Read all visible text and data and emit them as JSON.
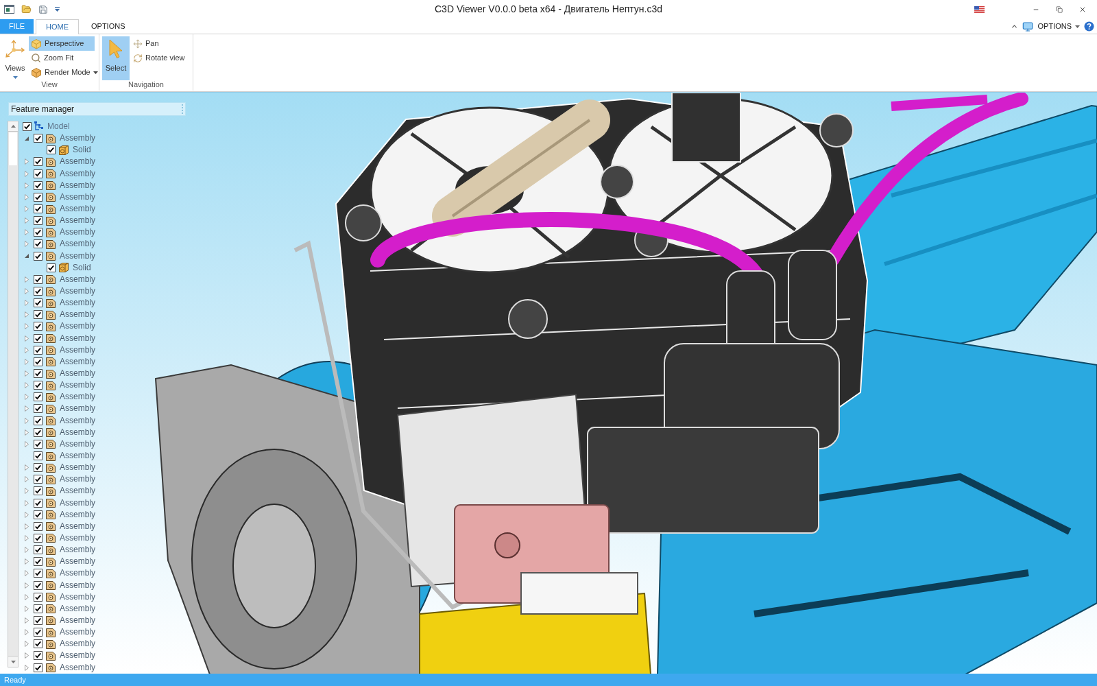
{
  "window": {
    "title": "C3D Viewer V0.0.0 beta x64 - Двигатель Нептун.c3d"
  },
  "ribbon": {
    "tabs": [
      {
        "label": "FILE",
        "kind": "file",
        "selected": false
      },
      {
        "label": "HOME",
        "kind": "tab",
        "selected": true
      },
      {
        "label": "OPTIONS",
        "kind": "tab",
        "selected": false
      }
    ],
    "options_menu": {
      "label": "OPTIONS"
    },
    "groups": [
      {
        "label": "View",
        "large": {
          "label": "Views",
          "selected": false,
          "dropdown": true
        },
        "small": [
          {
            "label": "Perspective",
            "selected": true,
            "dropdown": false
          },
          {
            "label": "Zoom Fit",
            "selected": false,
            "dropdown": false
          },
          {
            "label": "Render Mode",
            "selected": false,
            "dropdown": true
          }
        ]
      },
      {
        "label": "Navigation",
        "large": {
          "label": "Select",
          "selected": true,
          "dropdown": false
        },
        "small": [
          {
            "label": "Pan",
            "selected": false,
            "dropdown": false
          },
          {
            "label": "Rotate view",
            "selected": false,
            "dropdown": false
          }
        ]
      }
    ]
  },
  "feature_manager": {
    "title": "Feature manager",
    "tree": [
      {
        "label": "Model",
        "kind": "model",
        "checked": true,
        "expandable": false,
        "children": [
          {
            "label": "Assembly",
            "kind": "assembly",
            "checked": true,
            "expandable": true,
            "expanded": true,
            "children": [
              {
                "label": "Solid",
                "kind": "solid",
                "checked": true,
                "expandable": false
              }
            ]
          },
          {
            "label": "Assembly",
            "kind": "assembly",
            "checked": true,
            "expandable": true,
            "expanded": false
          },
          {
            "label": "Assembly",
            "kind": "assembly",
            "checked": true,
            "expandable": true,
            "expanded": false
          },
          {
            "label": "Assembly",
            "kind": "assembly",
            "checked": true,
            "expandable": true,
            "expanded": false
          },
          {
            "label": "Assembly",
            "kind": "assembly",
            "checked": true,
            "expandable": true,
            "expanded": false
          },
          {
            "label": "Assembly",
            "kind": "assembly",
            "checked": true,
            "expandable": true,
            "expanded": false
          },
          {
            "label": "Assembly",
            "kind": "assembly",
            "checked": true,
            "expandable": true,
            "expanded": false
          },
          {
            "label": "Assembly",
            "kind": "assembly",
            "checked": true,
            "expandable": true,
            "expanded": false
          },
          {
            "label": "Assembly",
            "kind": "assembly",
            "checked": true,
            "expandable": true,
            "expanded": false
          },
          {
            "label": "Assembly",
            "kind": "assembly",
            "checked": true,
            "expandable": true,
            "expanded": true,
            "children": [
              {
                "label": "Solid",
                "kind": "solid",
                "checked": true,
                "expandable": false
              }
            ]
          },
          {
            "label": "Assembly",
            "kind": "assembly",
            "checked": true,
            "expandable": true,
            "expanded": false
          },
          {
            "label": "Assembly",
            "kind": "assembly",
            "checked": true,
            "expandable": true,
            "expanded": false
          },
          {
            "label": "Assembly",
            "kind": "assembly",
            "checked": true,
            "expandable": true,
            "expanded": false
          },
          {
            "label": "Assembly",
            "kind": "assembly",
            "checked": true,
            "expandable": true,
            "expanded": false
          },
          {
            "label": "Assembly",
            "kind": "assembly",
            "checked": true,
            "expandable": true,
            "expanded": false
          },
          {
            "label": "Assembly",
            "kind": "assembly",
            "checked": true,
            "expandable": true,
            "expanded": false
          },
          {
            "label": "Assembly",
            "kind": "assembly",
            "checked": true,
            "expandable": true,
            "expanded": false
          },
          {
            "label": "Assembly",
            "kind": "assembly",
            "checked": true,
            "expandable": true,
            "expanded": false
          },
          {
            "label": "Assembly",
            "kind": "assembly",
            "checked": true,
            "expandable": true,
            "expanded": false
          },
          {
            "label": "Assembly",
            "kind": "assembly",
            "checked": true,
            "expandable": true,
            "expanded": false
          },
          {
            "label": "Assembly",
            "kind": "assembly",
            "checked": true,
            "expandable": true,
            "expanded": false
          },
          {
            "label": "Assembly",
            "kind": "assembly",
            "checked": true,
            "expandable": true,
            "expanded": false
          },
          {
            "label": "Assembly",
            "kind": "assembly",
            "checked": true,
            "expandable": true,
            "expanded": false
          },
          {
            "label": "Assembly",
            "kind": "assembly",
            "checked": true,
            "expandable": true,
            "expanded": false
          },
          {
            "label": "Assembly",
            "kind": "assembly",
            "checked": true,
            "expandable": true,
            "expanded": false
          },
          {
            "label": "Assembly",
            "kind": "assembly",
            "checked": true,
            "expandable": false
          },
          {
            "label": "Assembly",
            "kind": "assembly",
            "checked": true,
            "expandable": true,
            "expanded": false
          },
          {
            "label": "Assembly",
            "kind": "assembly",
            "checked": true,
            "expandable": true,
            "expanded": false
          },
          {
            "label": "Assembly",
            "kind": "assembly",
            "checked": true,
            "expandable": true,
            "expanded": false
          },
          {
            "label": "Assembly",
            "kind": "assembly",
            "checked": true,
            "expandable": true,
            "expanded": false
          },
          {
            "label": "Assembly",
            "kind": "assembly",
            "checked": true,
            "expandable": true,
            "expanded": false
          },
          {
            "label": "Assembly",
            "kind": "assembly",
            "checked": true,
            "expandable": true,
            "expanded": false
          },
          {
            "label": "Assembly",
            "kind": "assembly",
            "checked": true,
            "expandable": true,
            "expanded": false
          },
          {
            "label": "Assembly",
            "kind": "assembly",
            "checked": true,
            "expandable": true,
            "expanded": false
          },
          {
            "label": "Assembly",
            "kind": "assembly",
            "checked": true,
            "expandable": true,
            "expanded": false
          },
          {
            "label": "Assembly",
            "kind": "assembly",
            "checked": true,
            "expandable": true,
            "expanded": false
          },
          {
            "label": "Assembly",
            "kind": "assembly",
            "checked": true,
            "expandable": true,
            "expanded": false
          },
          {
            "label": "Assembly",
            "kind": "assembly",
            "checked": true,
            "expandable": true,
            "expanded": false
          },
          {
            "label": "Assembly",
            "kind": "assembly",
            "checked": true,
            "expandable": true,
            "expanded": false
          },
          {
            "label": "Assembly",
            "kind": "assembly",
            "checked": true,
            "expandable": true,
            "expanded": false
          },
          {
            "label": "Assembly",
            "kind": "assembly",
            "checked": true,
            "expandable": true,
            "expanded": false
          },
          {
            "label": "Assembly",
            "kind": "assembly",
            "checked": true,
            "expandable": true,
            "expanded": false
          },
          {
            "label": "Assembly",
            "kind": "assembly",
            "checked": true,
            "expandable": true,
            "expanded": false
          },
          {
            "label": "Assembly",
            "kind": "assembly",
            "checked": true,
            "expandable": true,
            "expanded": false
          }
        ]
      }
    ]
  },
  "status_bar": {
    "text": "Ready"
  }
}
